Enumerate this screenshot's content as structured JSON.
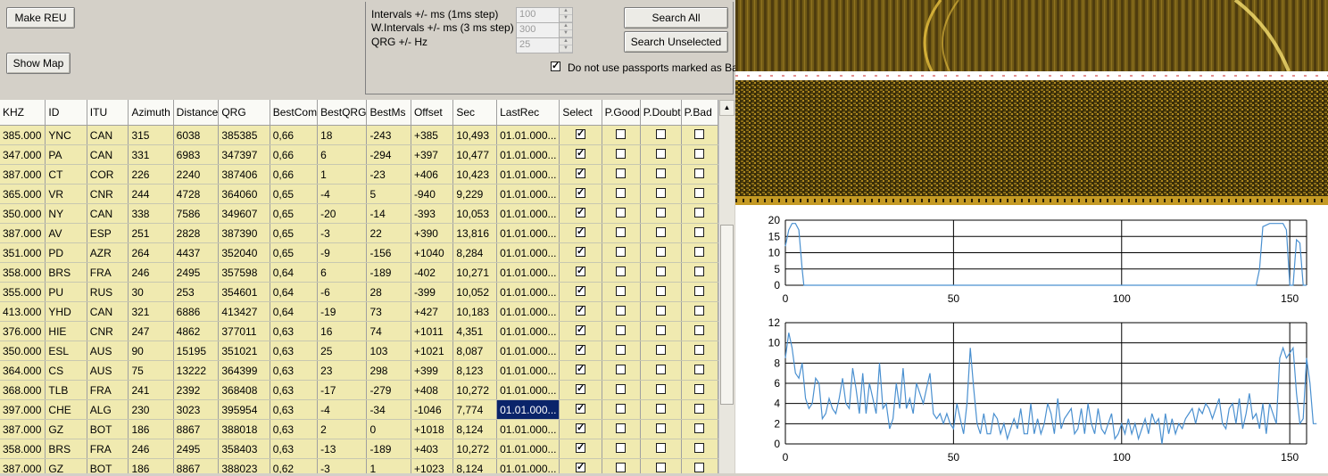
{
  "buttons": {
    "make_reu": "Make REU",
    "show_map": "Show Map",
    "search_all": "Search All",
    "search_unselected": "Search Unselected"
  },
  "params": {
    "intervals_label": "Intervals +/- ms (1ms step)",
    "intervals_value": "100",
    "w_intervals_label": "W.Intervals +/- ms (3 ms step)",
    "w_intervals_value": "300",
    "qrg_label": "QRG +/- Hz",
    "qrg_value": "25",
    "do_not_use_label": "Do not use passports marked as Bad",
    "do_not_use_checked": true
  },
  "table": {
    "columns": [
      "KHZ",
      "ID",
      "ITU",
      "Azimuth",
      "Distance",
      "QRG",
      "BestCom",
      "BestQRG",
      "BestMs",
      "Offset",
      "Sec",
      "LastRec",
      "Select",
      "P.Good",
      "P.Doubt",
      "P.Bad"
    ],
    "rows": [
      {
        "khz": "385.000",
        "id": "YNC",
        "itu": "CAN",
        "az": "315",
        "dist": "6038",
        "qrg": "385385",
        "bc": "0,66",
        "bq": "18",
        "bm": "-243",
        "off": "+385",
        "sec": "10,493",
        "last": "01.01.000..."
      },
      {
        "khz": "347.000",
        "id": "PA",
        "itu": "CAN",
        "az": "331",
        "dist": "6983",
        "qrg": "347397",
        "bc": "0,66",
        "bq": "6",
        "bm": "-294",
        "off": "+397",
        "sec": "10,477",
        "last": "01.01.000..."
      },
      {
        "khz": "387.000",
        "id": "CT",
        "itu": "COR",
        "az": "226",
        "dist": "2240",
        "qrg": "387406",
        "bc": "0,66",
        "bq": "1",
        "bm": "-23",
        "off": "+406",
        "sec": "10,423",
        "last": "01.01.000..."
      },
      {
        "khz": "365.000",
        "id": "VR",
        "itu": "CNR",
        "az": "244",
        "dist": "4728",
        "qrg": "364060",
        "bc": "0,65",
        "bq": "-4",
        "bm": "5",
        "off": "-940",
        "sec": "9,229",
        "last": "01.01.000..."
      },
      {
        "khz": "350.000",
        "id": "NY",
        "itu": "CAN",
        "az": "338",
        "dist": "7586",
        "qrg": "349607",
        "bc": "0,65",
        "bq": "-20",
        "bm": "-14",
        "off": "-393",
        "sec": "10,053",
        "last": "01.01.000..."
      },
      {
        "khz": "387.000",
        "id": "AV",
        "itu": "ESP",
        "az": "251",
        "dist": "2828",
        "qrg": "387390",
        "bc": "0,65",
        "bq": "-3",
        "bm": "22",
        "off": "+390",
        "sec": "13,816",
        "last": "01.01.000..."
      },
      {
        "khz": "351.000",
        "id": "PD",
        "itu": "AZR",
        "az": "264",
        "dist": "4437",
        "qrg": "352040",
        "bc": "0,65",
        "bq": "-9",
        "bm": "-156",
        "off": "+1040",
        "sec": "8,284",
        "last": "01.01.000..."
      },
      {
        "khz": "358.000",
        "id": "BRS",
        "itu": "FRA",
        "az": "246",
        "dist": "2495",
        "qrg": "357598",
        "bc": "0,64",
        "bq": "6",
        "bm": "-189",
        "off": "-402",
        "sec": "10,271",
        "last": "01.01.000..."
      },
      {
        "khz": "355.000",
        "id": "PU",
        "itu": "RUS",
        "az": "30",
        "dist": "253",
        "qrg": "354601",
        "bc": "0,64",
        "bq": "-6",
        "bm": "28",
        "off": "-399",
        "sec": "10,052",
        "last": "01.01.000..."
      },
      {
        "khz": "413.000",
        "id": "YHD",
        "itu": "CAN",
        "az": "321",
        "dist": "6886",
        "qrg": "413427",
        "bc": "0,64",
        "bq": "-19",
        "bm": "73",
        "off": "+427",
        "sec": "10,183",
        "last": "01.01.000..."
      },
      {
        "khz": "376.000",
        "id": "HIE",
        "itu": "CNR",
        "az": "247",
        "dist": "4862",
        "qrg": "377011",
        "bc": "0,63",
        "bq": "16",
        "bm": "74",
        "off": "+1011",
        "sec": "4,351",
        "last": "01.01.000..."
      },
      {
        "khz": "350.000",
        "id": "ESL",
        "itu": "AUS",
        "az": "90",
        "dist": "15195",
        "qrg": "351021",
        "bc": "0,63",
        "bq": "25",
        "bm": "103",
        "off": "+1021",
        "sec": "8,087",
        "last": "01.01.000..."
      },
      {
        "khz": "364.000",
        "id": "CS",
        "itu": "AUS",
        "az": "75",
        "dist": "13222",
        "qrg": "364399",
        "bc": "0,63",
        "bq": "23",
        "bm": "298",
        "off": "+399",
        "sec": "8,123",
        "last": "01.01.000..."
      },
      {
        "khz": "368.000",
        "id": "TLB",
        "itu": "FRA",
        "az": "241",
        "dist": "2392",
        "qrg": "368408",
        "bc": "0,63",
        "bq": "-17",
        "bm": "-279",
        "off": "+408",
        "sec": "10,272",
        "last": "01.01.000..."
      },
      {
        "khz": "397.000",
        "id": "CHE",
        "itu": "ALG",
        "az": "230",
        "dist": "3023",
        "qrg": "395954",
        "bc": "0,63",
        "bq": "-4",
        "bm": "-34",
        "off": "-1046",
        "sec": "7,774",
        "last": "01.01.000...",
        "selected": true
      },
      {
        "khz": "387.000",
        "id": "GZ",
        "itu": "BOT",
        "az": "186",
        "dist": "8867",
        "qrg": "388018",
        "bc": "0,63",
        "bq": "2",
        "bm": "0",
        "off": "+1018",
        "sec": "8,124",
        "last": "01.01.000..."
      },
      {
        "khz": "358.000",
        "id": "BRS",
        "itu": "FRA",
        "az": "246",
        "dist": "2495",
        "qrg": "358403",
        "bc": "0,63",
        "bq": "-13",
        "bm": "-189",
        "off": "+403",
        "sec": "10,272",
        "last": "01.01.000..."
      },
      {
        "khz": "387.000",
        "id": "GZ",
        "itu": "BOT",
        "az": "186",
        "dist": "8867",
        "qrg": "388023",
        "bc": "0,62",
        "bq": "-3",
        "bm": "1",
        "off": "+1023",
        "sec": "8,124",
        "last": "01.01.000..."
      }
    ]
  },
  "chart_data": [
    {
      "type": "line",
      "xlim": [
        0,
        155
      ],
      "ylim": [
        0,
        20
      ],
      "xticks": [
        "0",
        "50",
        "100",
        "150"
      ],
      "yticks": [
        "0",
        "5",
        "10",
        "15",
        "20"
      ],
      "color": "#4a90d0",
      "x": [
        0,
        1,
        2,
        3,
        4,
        5,
        5.5,
        6,
        140,
        141,
        142,
        144,
        146,
        148,
        149,
        150,
        151,
        152,
        153,
        154,
        155
      ],
      "y": [
        12,
        17,
        19,
        19,
        17,
        5,
        0,
        0,
        0,
        5,
        18,
        19,
        19,
        19,
        17,
        0,
        0,
        14,
        13,
        0,
        0
      ]
    },
    {
      "type": "line",
      "xlim": [
        0,
        155
      ],
      "ylim": [
        0,
        12
      ],
      "xticks": [
        "0",
        "50",
        "100",
        "150"
      ],
      "yticks": [
        "0",
        "2",
        "4",
        "6",
        "8",
        "10",
        "12"
      ],
      "color": "#4a90d0",
      "y": [
        8.5,
        11,
        9.5,
        7,
        6.5,
        8,
        4.5,
        3.5,
        4,
        6.5,
        6,
        2.5,
        3,
        4.5,
        3.5,
        3,
        4.5,
        6.5,
        4,
        3.5,
        7.5,
        5.5,
        3,
        7,
        3,
        6,
        4.5,
        3,
        8,
        3.5,
        4,
        1.5,
        2.5,
        6,
        3.5,
        7.5,
        3.5,
        4.5,
        3,
        6,
        5,
        4,
        5.5,
        7,
        3,
        2.5,
        3,
        2,
        3,
        2,
        1.5,
        4,
        2.5,
        1,
        4,
        9.5,
        5.5,
        2,
        1,
        3,
        1,
        1,
        3,
        2.5,
        1,
        2,
        0.5,
        1.5,
        2.5,
        1.5,
        3.5,
        1,
        1,
        4,
        1,
        2.5,
        1,
        2,
        4,
        3,
        1,
        4.5,
        1.5,
        2.5,
        3,
        3.5,
        1,
        1.5,
        3.5,
        1,
        4,
        2,
        1,
        3.5,
        1.5,
        1,
        2,
        3,
        0.5,
        1,
        2,
        1,
        2.5,
        1,
        2,
        0.5,
        1.5,
        2.5,
        1,
        3,
        2,
        2.5,
        0,
        3,
        1,
        2.5,
        1,
        2,
        1.5,
        2.5,
        3,
        3.5,
        2,
        3.5,
        3,
        4,
        3.5,
        2.5,
        3.5,
        4.5,
        2,
        1.5,
        3.5,
        4,
        2,
        4.5,
        1.5,
        3,
        5,
        2.5,
        3,
        1.5,
        4,
        1,
        4,
        3,
        2,
        8.5,
        9.5,
        8.5,
        9,
        9.5,
        5,
        2,
        2.5,
        8.5,
        6,
        2,
        2
      ]
    }
  ]
}
